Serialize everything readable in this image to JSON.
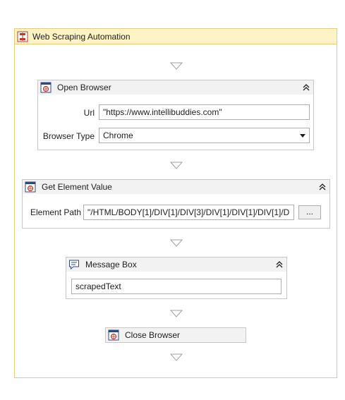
{
  "sequence": {
    "title": "Web Scraping Automation"
  },
  "open_browser": {
    "title": "Open Browser",
    "url_label": "Url",
    "url_value": "\"https://www.intellibuddies.com\"",
    "browser_type_label": "Browser Type",
    "browser_type_value": "Chrome"
  },
  "get_element_value": {
    "title": "Get Element Value",
    "element_path_label": "Element Path",
    "element_path_value": "\"/HTML/BODY[1]/DIV[1]/DIV[3]/DIV[1]/DIV[1]/DIV[1]/D",
    "browse_button_label": "..."
  },
  "message_box": {
    "title": "Message Box",
    "text_value": "scrapedText"
  },
  "close_browser": {
    "title": "Close Browser"
  },
  "colors": {
    "sequence_header_bg": "#fdf3c4",
    "sequence_border": "#e3cd7c",
    "activity_header_bg": "#f2f2f2",
    "activity_border": "#c8c8c8"
  }
}
